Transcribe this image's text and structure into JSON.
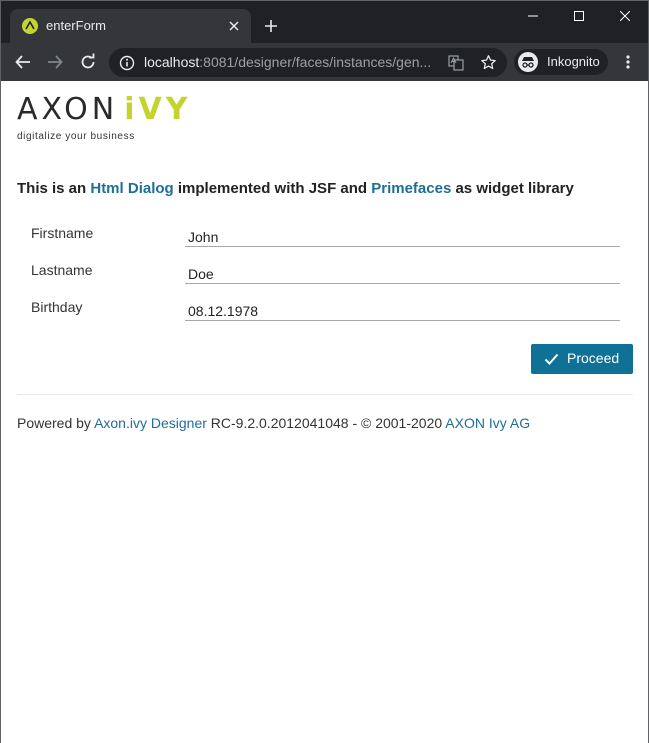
{
  "browser": {
    "tab_title": "enterForm",
    "url_host": "localhost",
    "url_rest": ":8081/designer/faces/instances/gen...",
    "profile_label": "Inkognito",
    "icons": {
      "favicon": "axon-ivy-favicon",
      "tab_close": "close-icon",
      "new_tab": "plus-icon",
      "back": "arrow-left-icon",
      "forward": "arrow-right-icon",
      "reload": "reload-icon",
      "info": "info-icon",
      "translate": "translate-icon",
      "bookmark": "star-icon",
      "incognito": "incognito-icon",
      "menu": "kebab-menu-icon"
    },
    "colors": {
      "frame": "#202124",
      "toolbar": "#35363a",
      "text": "#e8eaed"
    }
  },
  "logo": {
    "word_left": "AXON",
    "word_right": "iVY",
    "tagline": "digitalize your business",
    "colors": {
      "dark": "#2b2b2b",
      "accent": "#c4d42e"
    }
  },
  "intro": {
    "part1": "This is an ",
    "link1": "Html Dialog",
    "part2": " implemented with JSF and ",
    "link2": "Primefaces",
    "part3": " as widget library"
  },
  "form": {
    "fields": [
      {
        "label": "Firstname",
        "value": "John"
      },
      {
        "label": "Lastname",
        "value": "Doe"
      },
      {
        "label": "Birthday",
        "value": "08.12.1978"
      }
    ],
    "proceed_label": "Proceed",
    "proceed_icon": "check-icon",
    "colors": {
      "button": "#0e7195",
      "link": "#1f6e95"
    }
  },
  "footer": {
    "prefix": "Powered by ",
    "link_designer": "Axon.ivy Designer",
    "version": " RC-9.2.0.2012041048 - © 2001-2020 ",
    "link_company": "AXON Ivy AG"
  }
}
